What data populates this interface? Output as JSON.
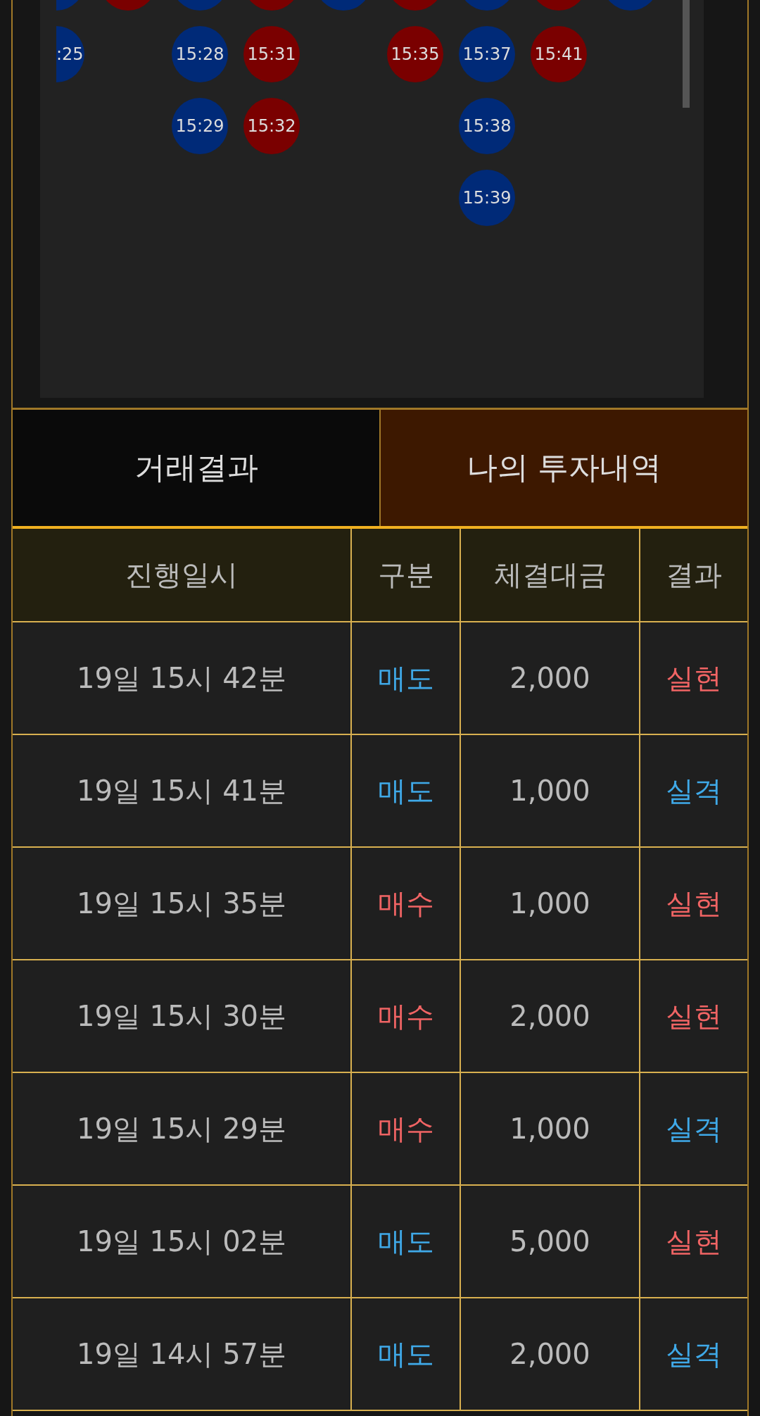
{
  "pattern": {
    "columns": [
      {
        "cut": true,
        "items": [
          {
            "color": "#002a78"
          },
          {
            "label": ":25",
            "color": "#002a78"
          }
        ]
      },
      {
        "items": [
          {
            "color": "#7a0000"
          }
        ]
      },
      {
        "items": [
          {
            "color": "#002a78"
          },
          {
            "label": "15:28",
            "color": "#002a78"
          },
          {
            "label": "15:29",
            "color": "#002a78"
          }
        ]
      },
      {
        "items": [
          {
            "color": "#7a0000"
          },
          {
            "label": "15:31",
            "color": "#7a0000"
          },
          {
            "label": "15:32",
            "color": "#7a0000"
          }
        ]
      },
      {
        "items": [
          {
            "color": "#002a78"
          }
        ]
      },
      {
        "items": [
          {
            "color": "#7a0000"
          },
          {
            "label": "15:35",
            "color": "#7a0000"
          }
        ]
      },
      {
        "items": [
          {
            "color": "#002a78"
          },
          {
            "label": "15:37",
            "color": "#002a78"
          },
          {
            "label": "15:38",
            "color": "#002a78"
          },
          {
            "label": "15:39",
            "color": "#002a78"
          }
        ]
      },
      {
        "items": [
          {
            "color": "#7a0000"
          },
          {
            "label": "15:41",
            "color": "#7a0000"
          }
        ]
      },
      {
        "items": [
          {
            "color": "#002a78"
          }
        ]
      }
    ]
  },
  "tabs": [
    {
      "label": "거래결과",
      "selected": false
    },
    {
      "label": "나의 투자내역",
      "selected": true
    }
  ],
  "table": {
    "columns": [
      "진행일시",
      "구분",
      "체결대금",
      "결과"
    ],
    "rows": [
      {
        "time": "19일 15시 42분",
        "side": {
          "text": "매도",
          "color": "#3fa9e8"
        },
        "amount": "2,000",
        "result": {
          "text": "실현",
          "color": "#f06464"
        }
      },
      {
        "time": "19일 15시 41분",
        "side": {
          "text": "매도",
          "color": "#3fa9e8"
        },
        "amount": "1,000",
        "result": {
          "text": "실격",
          "color": "#3fa9e8"
        }
      },
      {
        "time": "19일 15시 35분",
        "side": {
          "text": "매수",
          "color": "#f06464"
        },
        "amount": "1,000",
        "result": {
          "text": "실현",
          "color": "#f06464"
        }
      },
      {
        "time": "19일 15시 30분",
        "side": {
          "text": "매수",
          "color": "#f06464"
        },
        "amount": "2,000",
        "result": {
          "text": "실현",
          "color": "#f06464"
        }
      },
      {
        "time": "19일 15시 29분",
        "side": {
          "text": "매수",
          "color": "#f06464"
        },
        "amount": "1,000",
        "result": {
          "text": "실격",
          "color": "#3fa9e8"
        }
      },
      {
        "time": "19일 15시 02분",
        "side": {
          "text": "매도",
          "color": "#3fa9e8"
        },
        "amount": "5,000",
        "result": {
          "text": "실현",
          "color": "#f06464"
        }
      },
      {
        "time": "19일 14시 57분",
        "side": {
          "text": "매도",
          "color": "#3fa9e8"
        },
        "amount": "2,000",
        "result": {
          "text": "실격",
          "color": "#3fa9e8"
        }
      }
    ]
  }
}
